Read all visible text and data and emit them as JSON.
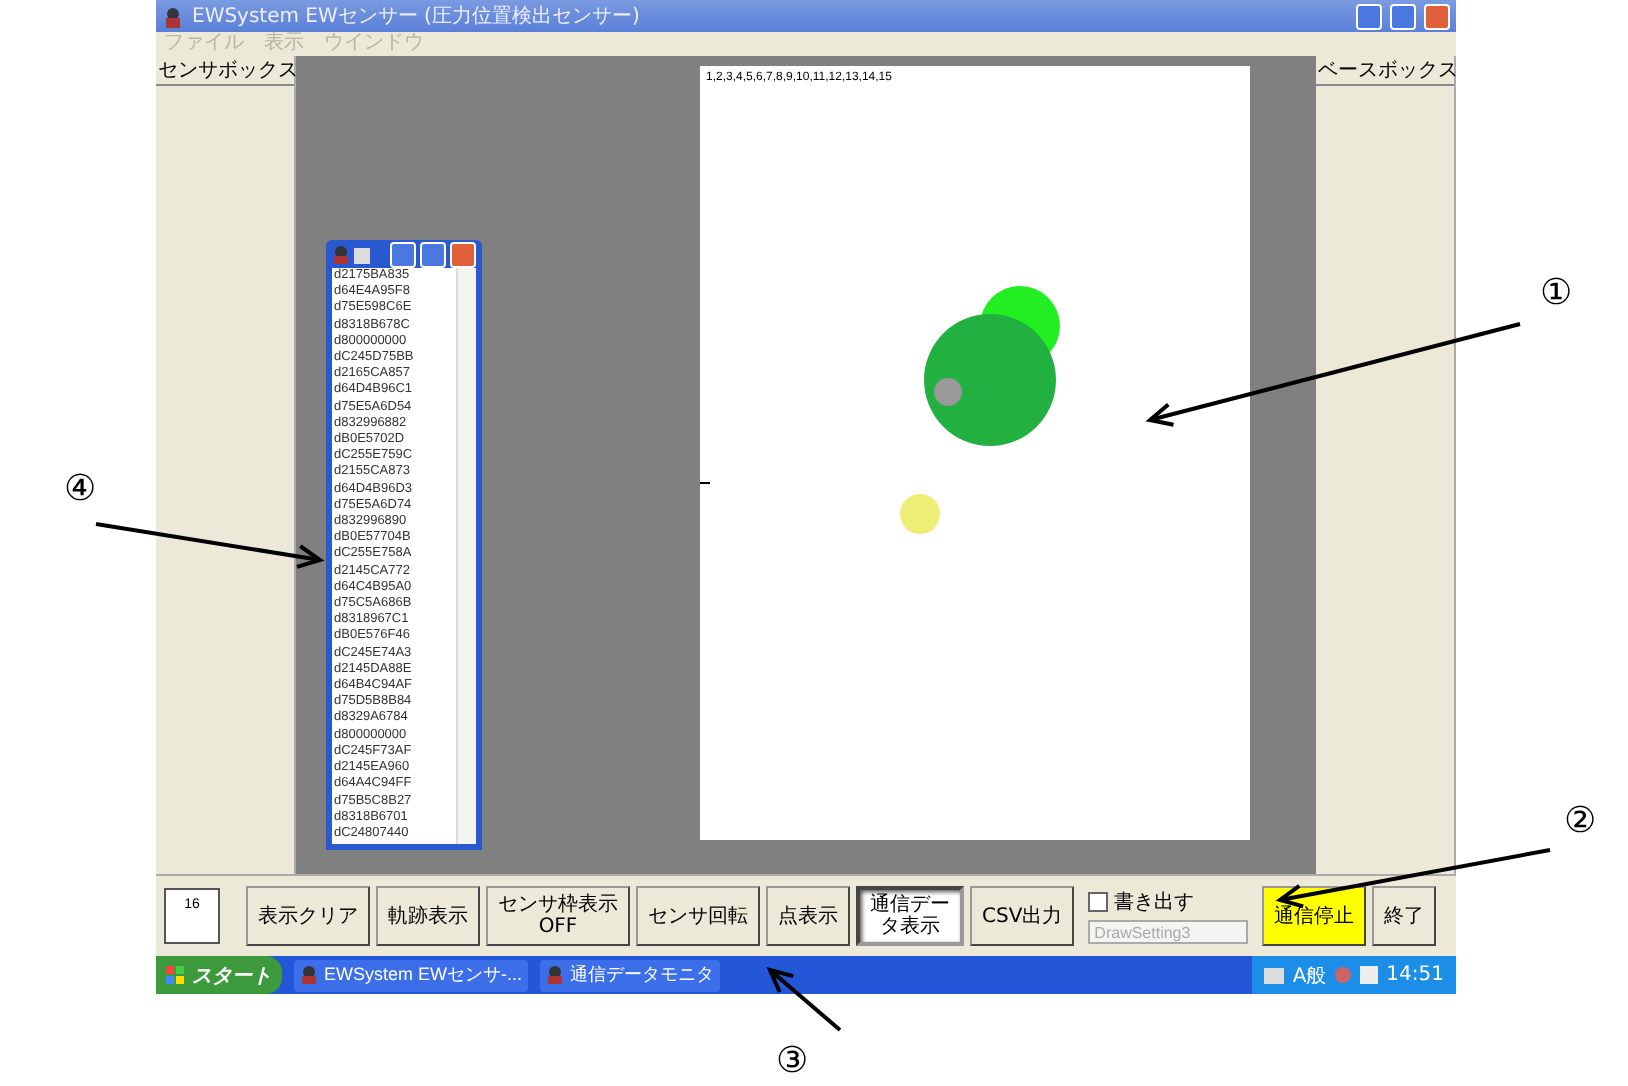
{
  "window": {
    "title": "EWSystem EWセンサー (圧力位置検出センサー)"
  },
  "menu": [
    {
      "label": "ファイル",
      "disabled": true
    },
    {
      "label": "表示",
      "disabled": true
    },
    {
      "label": "ウインドウ",
      "disabled": true
    }
  ],
  "left_panel": {
    "title": "センサボックス",
    "counter": "16"
  },
  "right_panel": {
    "title": "ベースボックス"
  },
  "canvas": {
    "header": "1,2,3,4,5,6,7,8,9,10,11,12,13,14,15"
  },
  "monitor": {
    "lines": [
      "d2175BA835",
      "d64E4A95F8",
      "d75E598C6E",
      "d8318B678C",
      "d800000000",
      "dC245D75BB",
      "d2165CA857",
      "d64D4B96C1",
      "d75E5A6D54",
      "d832996882",
      "dB0E5702D",
      "dC255E759C",
      "d2155CA873",
      "d64D4B96D3",
      "d75E5A6D74",
      "d832996890",
      "dB0E57704B",
      "dC255E758A",
      "d2145CA772",
      "d64C4B95A0",
      "d75C5A686B",
      "d8318967C1",
      "dB0E576F46",
      "dC245E74A3",
      "d2145DA88E",
      "d64B4C94AF",
      "d75D5B8B84",
      "d8329A6784",
      "d800000000",
      "dC245F73AF",
      "d2145EA960",
      "d64A4C94FF",
      "d75B5C8B27",
      "d8318B6701",
      "dC24807440"
    ]
  },
  "toolbar": [
    {
      "kind": "button",
      "lines": [
        "表示クリア"
      ],
      "pressed": false,
      "highlighted": false
    },
    {
      "kind": "button",
      "lines": [
        "軌跡表示"
      ],
      "pressed": false,
      "highlighted": false
    },
    {
      "kind": "button",
      "lines": [
        "センサ枠表示",
        "OFF"
      ],
      "pressed": false,
      "highlighted": false
    },
    {
      "kind": "button",
      "lines": [
        "センサ回転"
      ],
      "pressed": false,
      "highlighted": false
    },
    {
      "kind": "button",
      "lines": [
        "点表示"
      ],
      "pressed": false,
      "highlighted": false
    },
    {
      "kind": "button",
      "lines": [
        "通信デー",
        "タ表示"
      ],
      "pressed": true,
      "highlighted": false
    },
    {
      "kind": "button",
      "lines": [
        "CSV出力"
      ],
      "pressed": false,
      "highlighted": false
    },
    {
      "kind": "export",
      "label": "書き出す",
      "checked": false,
      "value": "DrawSetting3",
      "disabled": true
    },
    {
      "kind": "button",
      "lines": [
        "通信停止"
      ],
      "pressed": false,
      "highlighted": true
    },
    {
      "kind": "button",
      "lines": [
        "終了"
      ],
      "pressed": false,
      "highlighted": false
    }
  ],
  "taskbar": {
    "start": "スタート",
    "tasks": [
      "EWSystem EWセンサ-...",
      "通信データモニタ"
    ],
    "ime": "A般",
    "time": "14:51"
  },
  "annotations": [
    "①",
    "②",
    "③",
    "④"
  ]
}
